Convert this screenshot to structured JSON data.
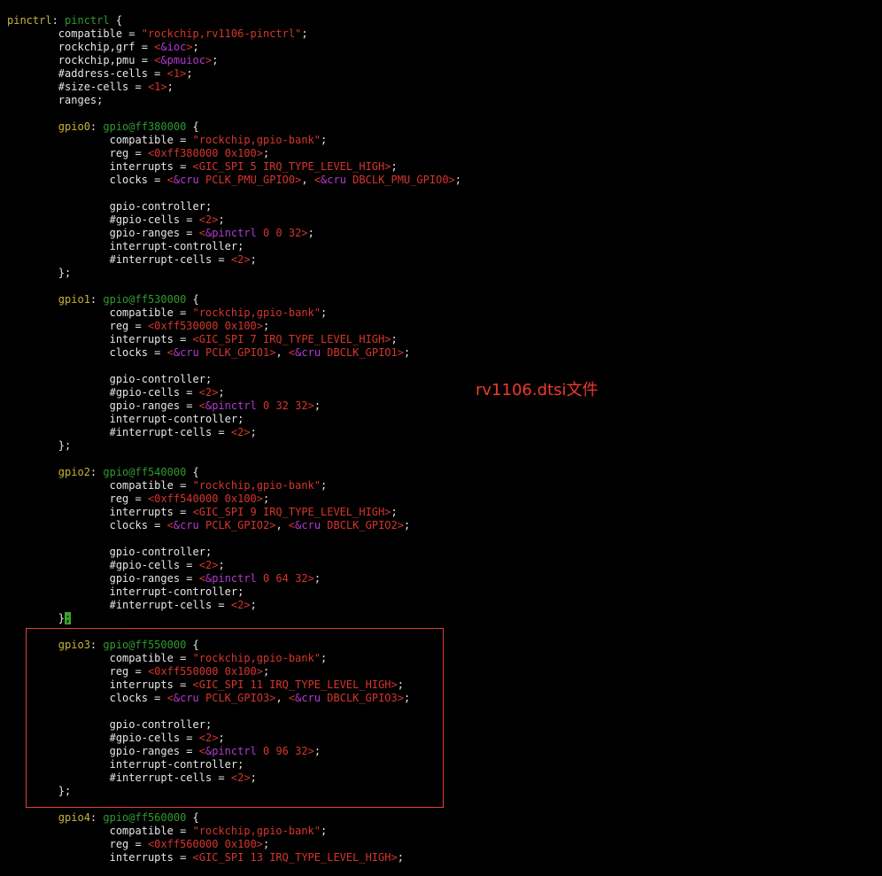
{
  "colors": {
    "background": "#000000",
    "default": "#e6e6e6",
    "label": "#c8b43a",
    "nodename": "#2f9a2f",
    "string": "#d5352d",
    "number": "#d5352d",
    "ref": "#b23bd0",
    "cursor": "#3aa12e",
    "annotation": "#ef3b2d"
  },
  "annotation": "rv1106.dtsi文件",
  "lines": [
    [
      {
        "t": "pinctrl",
        "c": "label"
      },
      {
        "t": ": ",
        "c": "default"
      },
      {
        "t": "pinctrl",
        "c": "nodename"
      },
      {
        "t": " {",
        "c": "default"
      }
    ],
    [
      {
        "t": "        compatible = ",
        "c": "default"
      },
      {
        "t": "\"rockchip,rv1106-pinctrl\"",
        "c": "string"
      },
      {
        "t": ";",
        "c": "default"
      }
    ],
    [
      {
        "t": "        rockchip,grf = ",
        "c": "default"
      },
      {
        "t": "<",
        "c": "number"
      },
      {
        "t": "&ioc",
        "c": "ref"
      },
      {
        "t": ">",
        "c": "number"
      },
      {
        "t": ";",
        "c": "default"
      }
    ],
    [
      {
        "t": "        rockchip,pmu = ",
        "c": "default"
      },
      {
        "t": "<",
        "c": "number"
      },
      {
        "t": "&pmuioc",
        "c": "ref"
      },
      {
        "t": ">",
        "c": "number"
      },
      {
        "t": ";",
        "c": "default"
      }
    ],
    [
      {
        "t": "        #address-cells = ",
        "c": "default"
      },
      {
        "t": "<1>",
        "c": "number"
      },
      {
        "t": ";",
        "c": "default"
      }
    ],
    [
      {
        "t": "        #size-cells = ",
        "c": "default"
      },
      {
        "t": "<1>",
        "c": "number"
      },
      {
        "t": ";",
        "c": "default"
      }
    ],
    [
      {
        "t": "        ranges;",
        "c": "default"
      }
    ],
    [],
    [
      {
        "t": "        ",
        "c": "default"
      },
      {
        "t": "gpio0",
        "c": "label"
      },
      {
        "t": ": ",
        "c": "default"
      },
      {
        "t": "gpio@ff380000",
        "c": "nodename"
      },
      {
        "t": " {",
        "c": "default"
      }
    ],
    [
      {
        "t": "                compatible = ",
        "c": "default"
      },
      {
        "t": "\"rockchip,gpio-bank\"",
        "c": "string"
      },
      {
        "t": ";",
        "c": "default"
      }
    ],
    [
      {
        "t": "                reg = ",
        "c": "default"
      },
      {
        "t": "<0xff380000 0x100>",
        "c": "number"
      },
      {
        "t": ";",
        "c": "default"
      }
    ],
    [
      {
        "t": "                interrupts = ",
        "c": "default"
      },
      {
        "t": "<GIC_SPI 5 IRQ_TYPE_LEVEL_HIGH>",
        "c": "number"
      },
      {
        "t": ";",
        "c": "default"
      }
    ],
    [
      {
        "t": "                clocks = ",
        "c": "default"
      },
      {
        "t": "<",
        "c": "number"
      },
      {
        "t": "&cru",
        "c": "ref"
      },
      {
        "t": " PCLK_PMU_GPIO0>",
        "c": "number"
      },
      {
        "t": ", ",
        "c": "default"
      },
      {
        "t": "<",
        "c": "number"
      },
      {
        "t": "&cru",
        "c": "ref"
      },
      {
        "t": " DBCLK_PMU_GPIO0>",
        "c": "number"
      },
      {
        "t": ";",
        "c": "default"
      }
    ],
    [],
    [
      {
        "t": "                gpio-controller;",
        "c": "default"
      }
    ],
    [
      {
        "t": "                #gpio-cells = ",
        "c": "default"
      },
      {
        "t": "<2>",
        "c": "number"
      },
      {
        "t": ";",
        "c": "default"
      }
    ],
    [
      {
        "t": "                gpio-ranges = ",
        "c": "default"
      },
      {
        "t": "<",
        "c": "number"
      },
      {
        "t": "&pinctrl",
        "c": "ref"
      },
      {
        "t": " 0 0 32>",
        "c": "number"
      },
      {
        "t": ";",
        "c": "default"
      }
    ],
    [
      {
        "t": "                interrupt-controller;",
        "c": "default"
      }
    ],
    [
      {
        "t": "                #interrupt-cells = ",
        "c": "default"
      },
      {
        "t": "<2>",
        "c": "number"
      },
      {
        "t": ";",
        "c": "default"
      }
    ],
    [
      {
        "t": "        };",
        "c": "default"
      }
    ],
    [],
    [
      {
        "t": "        ",
        "c": "default"
      },
      {
        "t": "gpio1",
        "c": "label"
      },
      {
        "t": ": ",
        "c": "default"
      },
      {
        "t": "gpio@ff530000",
        "c": "nodename"
      },
      {
        "t": " {",
        "c": "default"
      }
    ],
    [
      {
        "t": "                compatible = ",
        "c": "default"
      },
      {
        "t": "\"rockchip,gpio-bank\"",
        "c": "string"
      },
      {
        "t": ";",
        "c": "default"
      }
    ],
    [
      {
        "t": "                reg = ",
        "c": "default"
      },
      {
        "t": "<0xff530000 0x100>",
        "c": "number"
      },
      {
        "t": ";",
        "c": "default"
      }
    ],
    [
      {
        "t": "                interrupts = ",
        "c": "default"
      },
      {
        "t": "<GIC_SPI 7 IRQ_TYPE_LEVEL_HIGH>",
        "c": "number"
      },
      {
        "t": ";",
        "c": "default"
      }
    ],
    [
      {
        "t": "                clocks = ",
        "c": "default"
      },
      {
        "t": "<",
        "c": "number"
      },
      {
        "t": "&cru",
        "c": "ref"
      },
      {
        "t": " PCLK_GPIO1>",
        "c": "number"
      },
      {
        "t": ", ",
        "c": "default"
      },
      {
        "t": "<",
        "c": "number"
      },
      {
        "t": "&cru",
        "c": "ref"
      },
      {
        "t": " DBCLK_GPIO1>",
        "c": "number"
      },
      {
        "t": ";",
        "c": "default"
      }
    ],
    [],
    [
      {
        "t": "                gpio-controller;",
        "c": "default"
      }
    ],
    [
      {
        "t": "                #gpio-cells = ",
        "c": "default"
      },
      {
        "t": "<2>",
        "c": "number"
      },
      {
        "t": ";",
        "c": "default"
      }
    ],
    [
      {
        "t": "                gpio-ranges = ",
        "c": "default"
      },
      {
        "t": "<",
        "c": "number"
      },
      {
        "t": "&pinctrl",
        "c": "ref"
      },
      {
        "t": " 0 32 32>",
        "c": "number"
      },
      {
        "t": ";",
        "c": "default"
      }
    ],
    [
      {
        "t": "                interrupt-controller;",
        "c": "default"
      }
    ],
    [
      {
        "t": "                #interrupt-cells = ",
        "c": "default"
      },
      {
        "t": "<2>",
        "c": "number"
      },
      {
        "t": ";",
        "c": "default"
      }
    ],
    [
      {
        "t": "        };",
        "c": "default"
      }
    ],
    [],
    [
      {
        "t": "        ",
        "c": "default"
      },
      {
        "t": "gpio2",
        "c": "label"
      },
      {
        "t": ": ",
        "c": "default"
      },
      {
        "t": "gpio@ff540000",
        "c": "nodename"
      },
      {
        "t": " {",
        "c": "default"
      }
    ],
    [
      {
        "t": "                compatible = ",
        "c": "default"
      },
      {
        "t": "\"rockchip,gpio-bank\"",
        "c": "string"
      },
      {
        "t": ";",
        "c": "default"
      }
    ],
    [
      {
        "t": "                reg = ",
        "c": "default"
      },
      {
        "t": "<0xff540000 0x100>",
        "c": "number"
      },
      {
        "t": ";",
        "c": "default"
      }
    ],
    [
      {
        "t": "                interrupts = ",
        "c": "default"
      },
      {
        "t": "<GIC_SPI 9 IRQ_TYPE_LEVEL_HIGH>",
        "c": "number"
      },
      {
        "t": ";",
        "c": "default"
      }
    ],
    [
      {
        "t": "                clocks = ",
        "c": "default"
      },
      {
        "t": "<",
        "c": "number"
      },
      {
        "t": "&cru",
        "c": "ref"
      },
      {
        "t": " PCLK_GPIO2>",
        "c": "number"
      },
      {
        "t": ", ",
        "c": "default"
      },
      {
        "t": "<",
        "c": "number"
      },
      {
        "t": "&cru",
        "c": "ref"
      },
      {
        "t": " DBCLK_GPIO2>",
        "c": "number"
      },
      {
        "t": ";",
        "c": "default"
      }
    ],
    [],
    [
      {
        "t": "                gpio-controller;",
        "c": "default"
      }
    ],
    [
      {
        "t": "                #gpio-cells = ",
        "c": "default"
      },
      {
        "t": "<2>",
        "c": "number"
      },
      {
        "t": ";",
        "c": "default"
      }
    ],
    [
      {
        "t": "                gpio-ranges = ",
        "c": "default"
      },
      {
        "t": "<",
        "c": "number"
      },
      {
        "t": "&pinctrl",
        "c": "ref"
      },
      {
        "t": " 0 64 32>",
        "c": "number"
      },
      {
        "t": ";",
        "c": "default"
      }
    ],
    [
      {
        "t": "                interrupt-controller;",
        "c": "default"
      }
    ],
    [
      {
        "t": "                #interrupt-cells = ",
        "c": "default"
      },
      {
        "t": "<2>",
        "c": "number"
      },
      {
        "t": ";",
        "c": "default"
      }
    ],
    [
      {
        "t": "        }",
        "c": "default"
      },
      {
        "t": ";",
        "c": "cursor"
      }
    ],
    [],
    [
      {
        "t": "        ",
        "c": "default"
      },
      {
        "t": "gpio3",
        "c": "label"
      },
      {
        "t": ": ",
        "c": "default"
      },
      {
        "t": "gpio@ff550000",
        "c": "nodename"
      },
      {
        "t": " {",
        "c": "default"
      }
    ],
    [
      {
        "t": "                compatible = ",
        "c": "default"
      },
      {
        "t": "\"rockchip,gpio-bank\"",
        "c": "string"
      },
      {
        "t": ";",
        "c": "default"
      }
    ],
    [
      {
        "t": "                reg = ",
        "c": "default"
      },
      {
        "t": "<0xff550000 0x100>",
        "c": "number"
      },
      {
        "t": ";",
        "c": "default"
      }
    ],
    [
      {
        "t": "                interrupts = ",
        "c": "default"
      },
      {
        "t": "<GIC_SPI 11 IRQ_TYPE_LEVEL_HIGH>",
        "c": "number"
      },
      {
        "t": ";",
        "c": "default"
      }
    ],
    [
      {
        "t": "                clocks = ",
        "c": "default"
      },
      {
        "t": "<",
        "c": "number"
      },
      {
        "t": "&cru",
        "c": "ref"
      },
      {
        "t": " PCLK_GPIO3>",
        "c": "number"
      },
      {
        "t": ", ",
        "c": "default"
      },
      {
        "t": "<",
        "c": "number"
      },
      {
        "t": "&cru",
        "c": "ref"
      },
      {
        "t": " DBCLK_GPIO3>",
        "c": "number"
      },
      {
        "t": ";",
        "c": "default"
      }
    ],
    [],
    [
      {
        "t": "                gpio-controller;",
        "c": "default"
      }
    ],
    [
      {
        "t": "                #gpio-cells = ",
        "c": "default"
      },
      {
        "t": "<2>",
        "c": "number"
      },
      {
        "t": ";",
        "c": "default"
      }
    ],
    [
      {
        "t": "                gpio-ranges = ",
        "c": "default"
      },
      {
        "t": "<",
        "c": "number"
      },
      {
        "t": "&pinctrl",
        "c": "ref"
      },
      {
        "t": " 0 96 32>",
        "c": "number"
      },
      {
        "t": ";",
        "c": "default"
      }
    ],
    [
      {
        "t": "                interrupt-controller;",
        "c": "default"
      }
    ],
    [
      {
        "t": "                #interrupt-cells = ",
        "c": "default"
      },
      {
        "t": "<2>",
        "c": "number"
      },
      {
        "t": ";",
        "c": "default"
      }
    ],
    [
      {
        "t": "        };",
        "c": "default"
      }
    ],
    [],
    [
      {
        "t": "        ",
        "c": "default"
      },
      {
        "t": "gpio4",
        "c": "label"
      },
      {
        "t": ": ",
        "c": "default"
      },
      {
        "t": "gpio@ff560000",
        "c": "nodename"
      },
      {
        "t": " {",
        "c": "default"
      }
    ],
    [
      {
        "t": "                compatible = ",
        "c": "default"
      },
      {
        "t": "\"rockchip,gpio-bank\"",
        "c": "string"
      },
      {
        "t": ";",
        "c": "default"
      }
    ],
    [
      {
        "t": "                reg = ",
        "c": "default"
      },
      {
        "t": "<0xff560000 0x100>",
        "c": "number"
      },
      {
        "t": ";",
        "c": "default"
      }
    ],
    [
      {
        "t": "                interrupts = ",
        "c": "default"
      },
      {
        "t": "<GIC_SPI 13 IRQ_TYPE_LEVEL_HIGH>",
        "c": "number"
      },
      {
        "t": ";",
        "c": "default"
      }
    ]
  ]
}
